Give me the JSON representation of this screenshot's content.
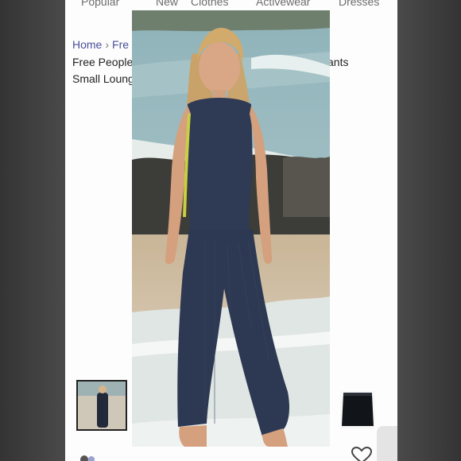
{
  "nav": {
    "items": [
      {
        "label": "Popular"
      },
      {
        "label": "New"
      },
      {
        "label": "Clothes"
      },
      {
        "label": "Activewear"
      },
      {
        "label": "Dresses"
      }
    ]
  },
  "breadcrumb": {
    "home": "Home",
    "next": "Fre"
  },
  "product": {
    "title_line1_left": "Free People",
    "title_line1_right": "ants",
    "title_line2": "Small Loung"
  },
  "colors": {
    "accent_link": "#4a4f9a",
    "outfit_navy": "#2f3a55"
  },
  "icons": [
    "chevron-right-icon",
    "heart-icon"
  ]
}
